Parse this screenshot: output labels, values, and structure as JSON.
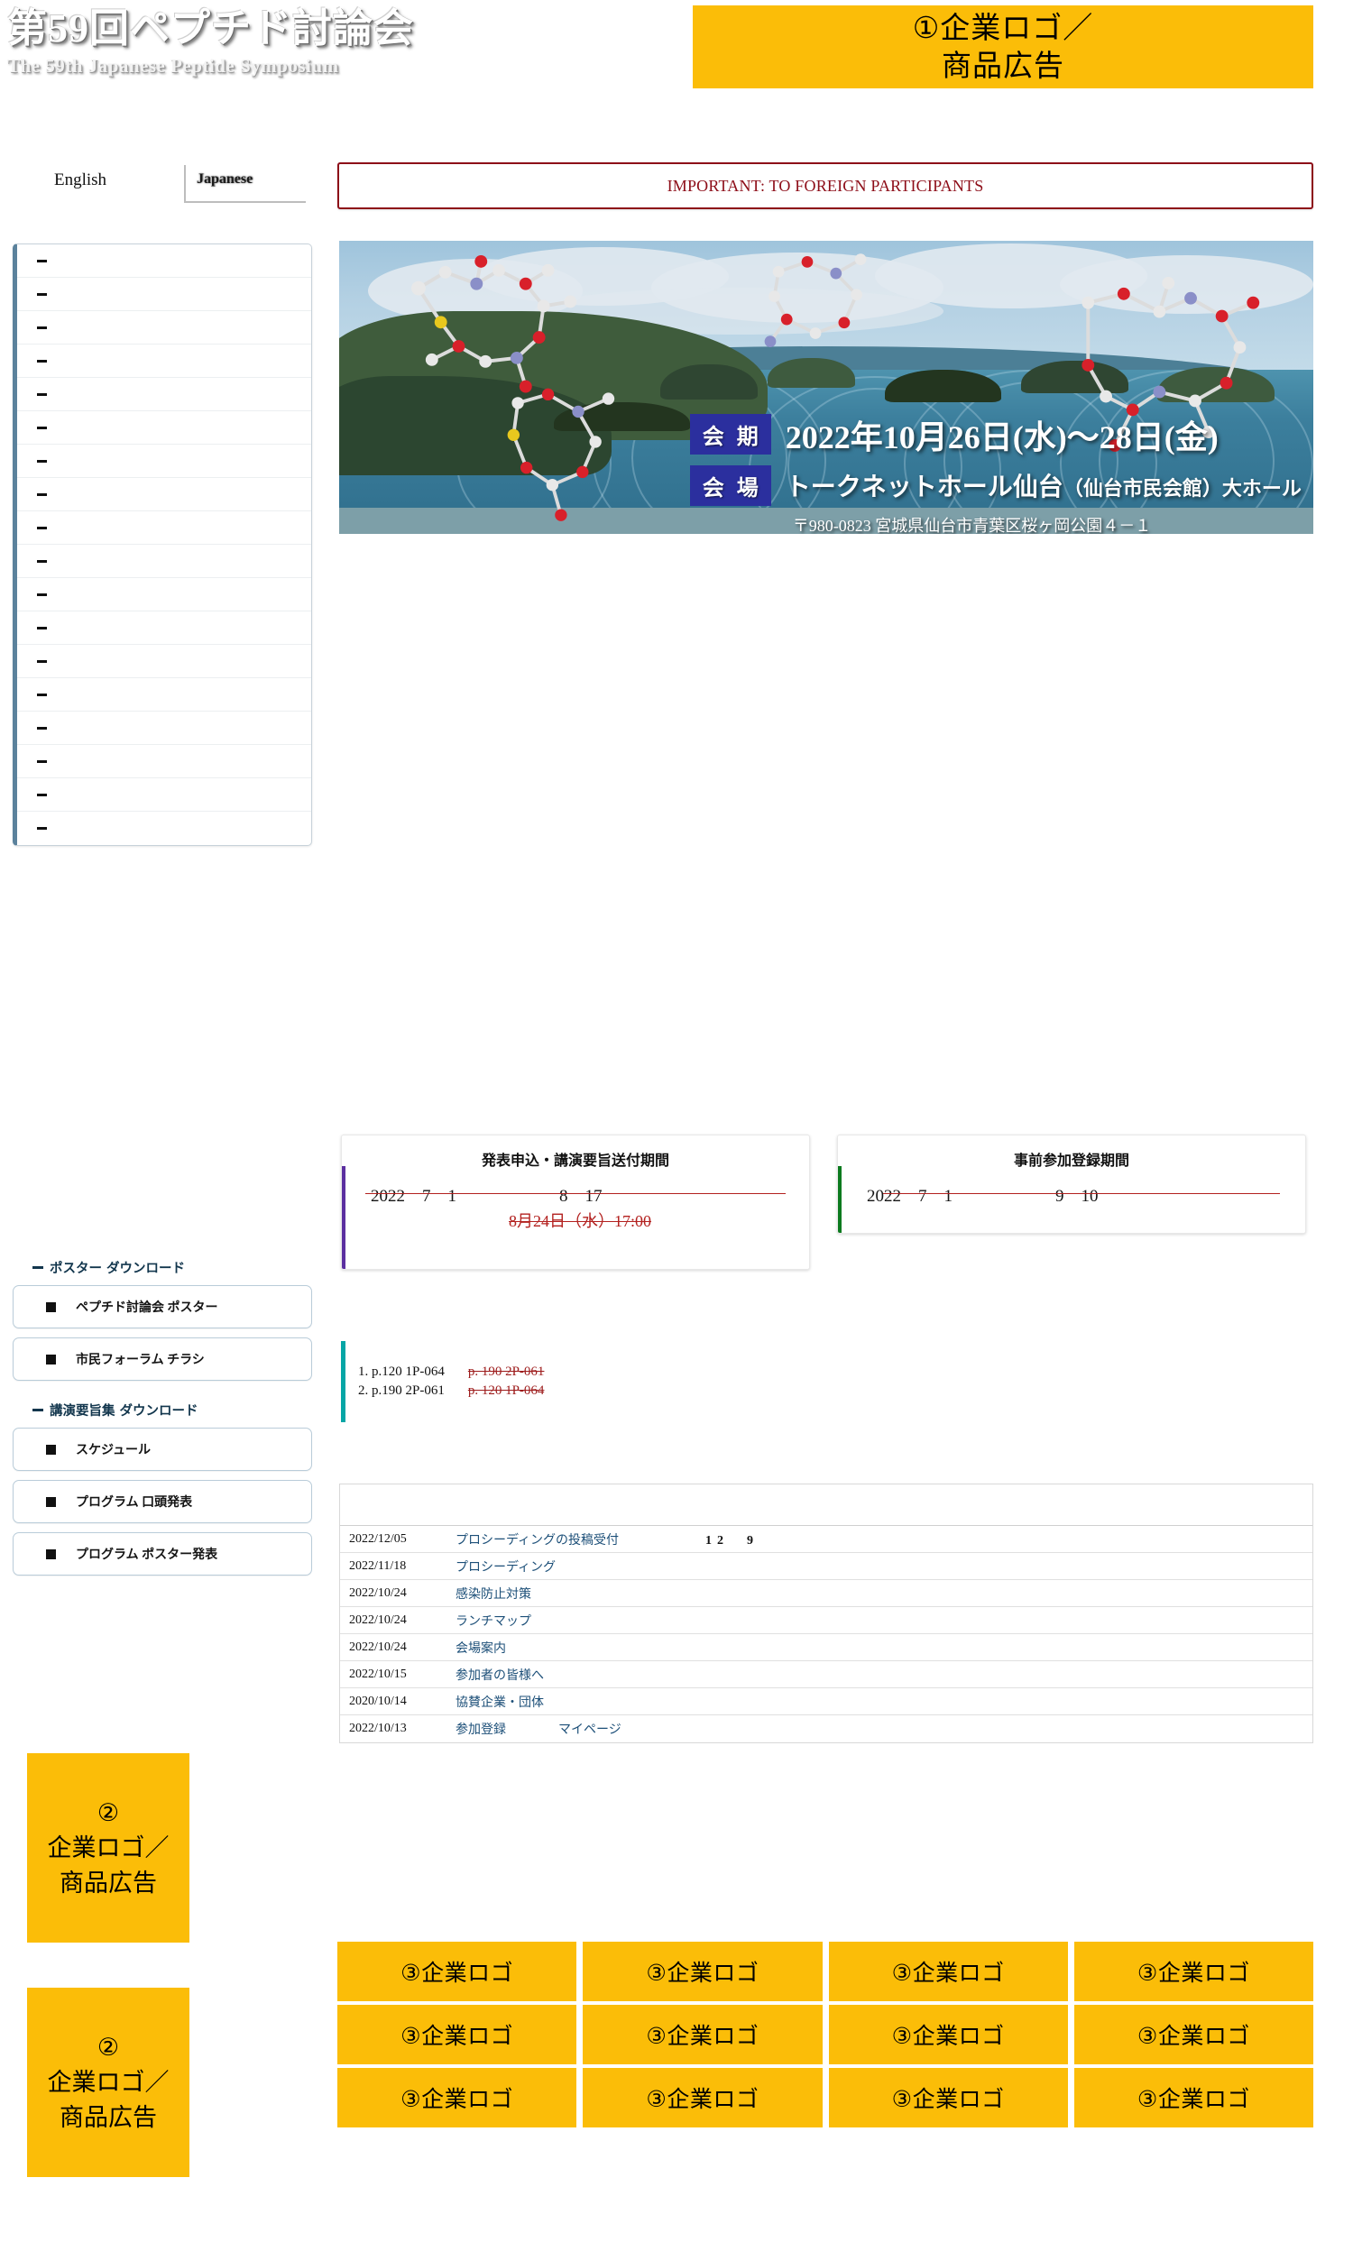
{
  "header": {
    "title_jp": "第59回ペプチド討論会",
    "title_en": "The 59th Japanese Peptide Symposium",
    "lang_en": "English",
    "lang_jp": "Japanese"
  },
  "ads": {
    "banner_top": "①企業ロゴ／\n商品広告",
    "banner_top_line1": "①企業ロゴ／",
    "banner_top_line2": "商品広告",
    "side_line1": "②",
    "side_line2": "企業ロゴ／",
    "side_line3": "商品広告",
    "accent_color": "#FBBD08",
    "logo_cell_label": "③企業ロゴ"
  },
  "sidebar": {
    "nav_items": [
      {
        "label": ""
      },
      {
        "label": ""
      },
      {
        "label": ""
      },
      {
        "label": ""
      },
      {
        "label": ""
      },
      {
        "label": ""
      },
      {
        "label": ""
      },
      {
        "label": ""
      },
      {
        "label": ""
      },
      {
        "label": ""
      },
      {
        "label": ""
      },
      {
        "label": ""
      },
      {
        "label": ""
      },
      {
        "label": ""
      },
      {
        "label": ""
      },
      {
        "label": ""
      },
      {
        "label": ""
      },
      {
        "label": ""
      }
    ],
    "poster_group": {
      "title": "ポスター ダウンロード",
      "buttons": [
        {
          "label": "ペプチド討論会 ポスター"
        },
        {
          "label": "市民フォーラム チラシ"
        }
      ]
    },
    "abstract_group": {
      "title": "講演要旨集 ダウンロード",
      "buttons": [
        {
          "label": "スケジュール"
        },
        {
          "label": "プログラム 口頭発表"
        },
        {
          "label": "プログラム ポスター発表"
        }
      ]
    }
  },
  "main": {
    "important_banner": "IMPORTANT: TO FOREIGN PARTICIPANTS",
    "hero": {
      "date_tag": "会 期",
      "date_value": "2022年10月26日(水)〜28日(金)",
      "venue_tag": "会 場",
      "venue_value": "トークネットホール仙台",
      "venue_value_sub": "（仙台市民会館）大ホール",
      "address": "〒980-0823 宮城県仙台市青葉区桜ヶ岡公園４－１"
    },
    "deadline_cards": [
      {
        "title": "発表申込・講演要旨送付期間",
        "line1": "2022　7　1　　　　　　8　17",
        "line2": "8月24日（水）17:00",
        "accent_color": "#5b2fa0"
      },
      {
        "title": "事前参加登録期間",
        "line1": "2022　7　1　　　　　　9　10",
        "line2": "",
        "accent_color": "#0b7a1e"
      }
    ],
    "errata": {
      "accent_color": "#06a6a6",
      "rows": [
        {
          "original": "1. p.120 1P-064",
          "fix": "p. 190 2P-061"
        },
        {
          "original": "2. p.190 2P-061",
          "fix": "p. 120 1P-064"
        }
      ]
    },
    "news": {
      "rows": [
        {
          "date": "2022/12/05",
          "text": "プロシーディングの投稿受付",
          "extra": "12　9",
          "extra_bold": true
        },
        {
          "date": "2022/11/18",
          "text": "プロシーディング",
          "extra": "",
          "extra_bold": false
        },
        {
          "date": "2022/10/24",
          "text": "感染防止対策",
          "extra": "",
          "extra_bold": false
        },
        {
          "date": "2022/10/24",
          "text": "ランチマップ",
          "extra": "",
          "extra_bold": false
        },
        {
          "date": "2022/10/24",
          "text": "会場案内",
          "extra": "",
          "extra_bold": false
        },
        {
          "date": "2022/10/15",
          "text": "参加者の皆様へ",
          "extra": "",
          "extra_bold": false
        },
        {
          "date": "2020/10/14",
          "text": "協賛企業・団体",
          "extra": "",
          "extra_bold": false
        },
        {
          "date": "2022/10/13",
          "text": "参加登録",
          "extra": "マイページ",
          "extra_bold": false
        }
      ]
    },
    "logo_grid": {
      "rows": 3,
      "cols": 4,
      "cells": [
        "③企業ロゴ",
        "③企業ロゴ",
        "③企業ロゴ",
        "③企業ロゴ",
        "③企業ロゴ",
        "③企業ロゴ",
        "③企業ロゴ",
        "③企業ロゴ",
        "③企業ロゴ",
        "③企業ロゴ",
        "③企業ロゴ",
        "③企業ロゴ"
      ]
    }
  }
}
